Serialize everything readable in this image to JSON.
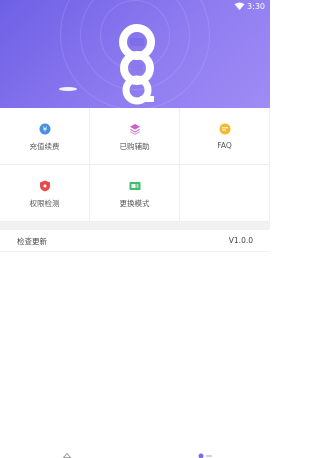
{
  "status_bar": {
    "time": "3:30",
    "wifi_icon": "wifi-icon"
  },
  "header": {
    "gradient_from": "#6e60e6",
    "gradient_to": "#a08cf5",
    "logo_icon": "app-logo"
  },
  "grid": {
    "items": [
      {
        "label": "充值续费",
        "icon": "recharge-icon",
        "color": "#4a90e2"
      },
      {
        "label": "已购辅助",
        "icon": "layers-icon",
        "color": "#d05fc8"
      },
      {
        "label": "FAQ",
        "icon": "faq-chat-icon",
        "color": "#f5b82e"
      },
      {
        "label": "权限检测",
        "icon": "shield-icon",
        "color": "#e84a4a"
      },
      {
        "label": "更换模式",
        "icon": "switch-mode-icon",
        "color": "#3cbf6a"
      }
    ]
  },
  "update": {
    "label": "检查更新",
    "version": "V1.0.0"
  },
  "bottom_nav": {
    "items": [
      {
        "icon": "home-icon"
      },
      {
        "icon": "user-icon"
      }
    ]
  }
}
